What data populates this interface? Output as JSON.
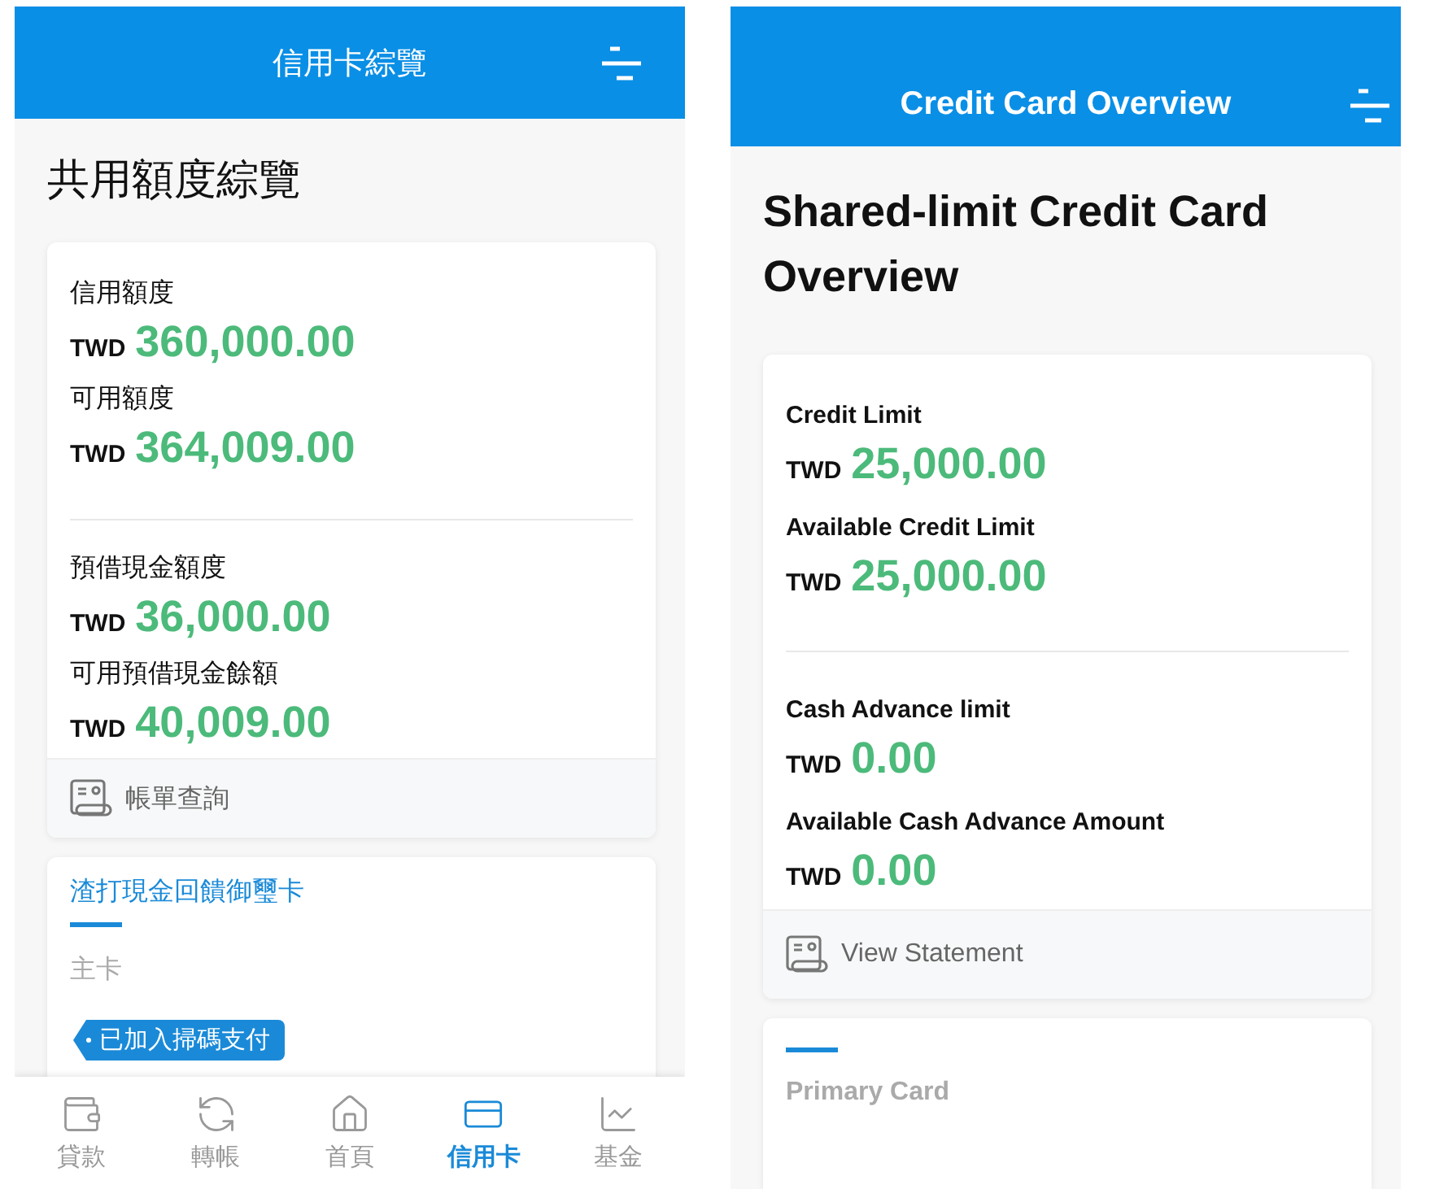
{
  "screens": [
    {
      "header": {
        "title": "信用卡綜覽"
      },
      "heading": "共用額度綜覽",
      "limit_groups": [
        [
          {
            "label": "信用額度",
            "currency": "TWD",
            "amount": "360,000.00"
          },
          {
            "label": "可用額度",
            "currency": "TWD",
            "amount": "364,009.00"
          }
        ],
        [
          {
            "label": "預借現金額度",
            "currency": "TWD",
            "amount": "36,000.00"
          },
          {
            "label": "可用預借現金餘額",
            "currency": "TWD",
            "amount": "40,009.00"
          }
        ]
      ],
      "statement_link": "帳單查詢",
      "card": {
        "name": "渣打現金回饋御璽卡",
        "type": "主卡",
        "tag": "已加入掃碼支付"
      },
      "bottom_nav": [
        {
          "label": "貸款",
          "selected": false
        },
        {
          "label": "轉帳",
          "selected": false
        },
        {
          "label": "首頁",
          "selected": false
        },
        {
          "label": "信用卡",
          "selected": true
        },
        {
          "label": "基金",
          "selected": false
        }
      ]
    },
    {
      "header": {
        "title": "Credit Card Overview"
      },
      "heading": "Shared-limit Credit Card Overview",
      "limit_groups": [
        [
          {
            "label": "Credit Limit",
            "currency": "TWD",
            "amount": "25,000.00"
          },
          {
            "label": "Available Credit Limit",
            "currency": "TWD",
            "amount": "25,000.00"
          }
        ],
        [
          {
            "label": "Cash Advance limit",
            "currency": "TWD",
            "amount": "0.00"
          },
          {
            "label": "Available Cash Advance Amount",
            "currency": "TWD",
            "amount": "0.00"
          }
        ]
      ],
      "statement_link": "View Statement",
      "card": {
        "type": "Primary Card"
      }
    }
  ]
}
